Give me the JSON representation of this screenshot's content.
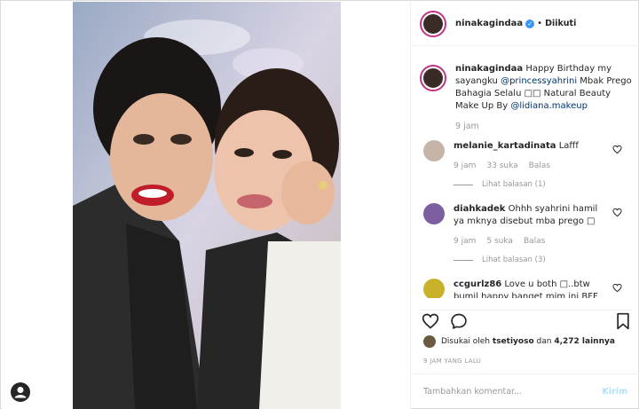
{
  "post": {
    "username": "ninakagindaa",
    "follow_status": "Diikuti",
    "caption_prefix": "Happy Birthday my sayangku ",
    "caption_mention1": "@princessyahrini",
    "caption_mid": " Mbak Prego Bahagia Selalu □□ Natural Beauty Make Up By ",
    "caption_mention2": "@lidiana.makeup",
    "caption_time": "9 jam"
  },
  "comments": [
    {
      "username": "melanie_kartadinata",
      "text": " Lafff",
      "time": "9 jam",
      "likes": "33 suka",
      "reply": "Balas",
      "view_replies": "Lihat balasan (1)",
      "avatar_color": "#c7b4a8"
    },
    {
      "username": "diahkadek",
      "text": " Ohhh syahrini hamil ya mknya disebut mba prego □",
      "time": "9 jam",
      "likes": "5 suka",
      "reply": "Balas",
      "view_replies": "Lihat balasan (3)",
      "avatar_color": "#7b5fa0"
    },
    {
      "username": "ccgurlz86",
      "text": " Love u both □..btw bumil happy banget mim ini BFF",
      "avatar_color": "#c9b22a"
    }
  ],
  "likes_line": {
    "prefix": "Disukai oleh ",
    "user": "tsetiyoso",
    "mid": " dan ",
    "count": "4,272 lainnya"
  },
  "posted_ago": "9 JAM YANG LALU",
  "add_comment": {
    "placeholder": "Tambahkan komentar...",
    "post_label": "Kirim"
  },
  "colors": {
    "accent": "#3897f0",
    "story_ring": "#c13584",
    "muted": "#999999",
    "post_disabled": "#b2dffc"
  },
  "icons": [
    "verified-badge-icon",
    "heart-icon",
    "comment-icon",
    "bookmark-icon",
    "user-tag-icon"
  ]
}
